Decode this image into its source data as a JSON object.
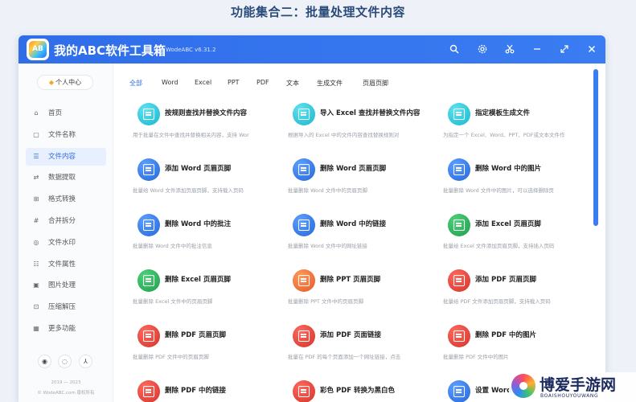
{
  "headline": "功能集合二：批量处理文件内容",
  "app": {
    "logo_text": "AB",
    "title": "我的ABC软件工具箱",
    "version": "WodeABC v6.31.2"
  },
  "titlebar_icons": [
    "search-icon",
    "gear-icon",
    "scissors-icon",
    "pin-icon",
    "resize-icon",
    "close-icon"
  ],
  "sidebar": {
    "personal_label": "个人中心",
    "items": [
      {
        "label": "首页",
        "icon": "home-icon",
        "active": false
      },
      {
        "label": "文件名称",
        "icon": "file-name-icon",
        "active": false
      },
      {
        "label": "文件内容",
        "icon": "file-content-icon",
        "active": true
      },
      {
        "label": "数据提取",
        "icon": "extract-icon",
        "active": false
      },
      {
        "label": "格式转换",
        "icon": "convert-icon",
        "active": false
      },
      {
        "label": "合并拆分",
        "icon": "merge-icon",
        "active": false
      },
      {
        "label": "文件水印",
        "icon": "watermark-icon",
        "active": false
      },
      {
        "label": "文件属性",
        "icon": "attribute-icon",
        "active": false
      },
      {
        "label": "图片处理",
        "icon": "image-icon",
        "active": false
      },
      {
        "label": "压缩解压",
        "icon": "compress-icon",
        "active": false
      },
      {
        "label": "更多功能",
        "icon": "more-icon",
        "active": false
      }
    ],
    "footer_years": "2019 — 2023",
    "footer_copyright": "© WodeABC.com 版权所有"
  },
  "tabs": [
    "全部",
    "Word",
    "Excel",
    "PPT",
    "PDF",
    "文本",
    "生成文件",
    "页眉页脚"
  ],
  "active_tab": "全部",
  "colors": {
    "accent": "#2f6de9",
    "cyan": "#16b6cf",
    "blue": "#2466d8",
    "green": "#1f9b4c",
    "orange": "#e4582a",
    "red": "#d3322a"
  },
  "cards": [
    {
      "title": "按规则查找并替换文件内容",
      "desc": "用于批量在文件中查找并替换相关内容，支持 Wor",
      "color": "cyan"
    },
    {
      "title": "导入 Excel 查找并替换文件内容",
      "desc": "根据导入的 Excel 中的文件内容查找替换规则对",
      "color": "cyan"
    },
    {
      "title": "指定模板生成文件",
      "desc": "为指定一个 Excel、Word、PPT、PDF或文本文件作",
      "color": "cyan"
    },
    {
      "title": "添加 Word 页眉页脚",
      "desc": "批量给 Word 文件添加页眉页脚，支持载入页码",
      "color": "blue"
    },
    {
      "title": "删除 Word 页眉页脚",
      "desc": "批量删除 Word 文件中的页眉页脚",
      "color": "blue"
    },
    {
      "title": "删除 Word 中的图片",
      "desc": "批量删除 Word 文件中的图片，可以选择删除页",
      "color": "blue"
    },
    {
      "title": "删除 Word 中的批注",
      "desc": "批量删除 Word 文件中的批注信息",
      "color": "blue"
    },
    {
      "title": "删除 Word 中的链接",
      "desc": "批量删除 Word 文件中的网址链接",
      "color": "blue"
    },
    {
      "title": "添加 Excel 页眉页脚",
      "desc": "批量给 Excel 文件添加页眉页脚，支持插入页码",
      "color": "green"
    },
    {
      "title": "删除 Excel 页眉页脚",
      "desc": "批量删除 Excel 文件中的页眉页脚",
      "color": "green"
    },
    {
      "title": "删除 PPT 页眉页脚",
      "desc": "批量删除 PPT 文件中的页眉页脚",
      "color": "orange"
    },
    {
      "title": "添加 PDF 页眉页脚",
      "desc": "批量给 PDF 文件添加页眉页脚，支持载入页码",
      "color": "red"
    },
    {
      "title": "删除 PDF 页眉页脚",
      "desc": "批量删除 PDF 文件中的页眉页脚",
      "color": "red"
    },
    {
      "title": "添加 PDF 页面链接",
      "desc": "批量在 PDF 的每个页面添加一个网址链接，点击",
      "color": "red"
    },
    {
      "title": "删除 PDF 中的图片",
      "desc": "批量删除 PDF 文件中的图片",
      "color": "red"
    },
    {
      "title": "删除 PDF 中的链接",
      "desc": "",
      "color": "red"
    },
    {
      "title": "彩色 PDF 转换为黑白色",
      "desc": "",
      "color": "red"
    },
    {
      "title": "设置 Word 格",
      "desc": "",
      "color": "blue"
    }
  ],
  "watermark": {
    "name": "博爱手游网",
    "domain": "BOAISHOUYOUWANG"
  }
}
